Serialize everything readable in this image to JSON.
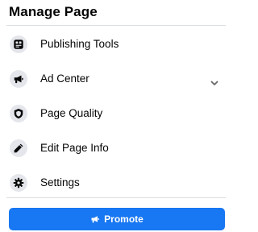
{
  "header": {
    "title": "Manage Page"
  },
  "menu": {
    "items": [
      {
        "label": "Publishing Tools",
        "icon": "publishing-tools-icon"
      },
      {
        "label": "Ad Center",
        "icon": "megaphone-icon",
        "expand_icon": "chevron-down-icon"
      },
      {
        "label": "Page Quality",
        "icon": "shield-icon"
      },
      {
        "label": "Edit Page Info",
        "icon": "pencil-icon"
      },
      {
        "label": "Settings",
        "icon": "gear-icon"
      }
    ]
  },
  "promote": {
    "label": "Promote",
    "icon": "megaphone-icon"
  },
  "colors": {
    "accent": "#1877f2",
    "icon_bg": "#e4e6eb",
    "text": "#050505",
    "divider": "#dadde1"
  }
}
